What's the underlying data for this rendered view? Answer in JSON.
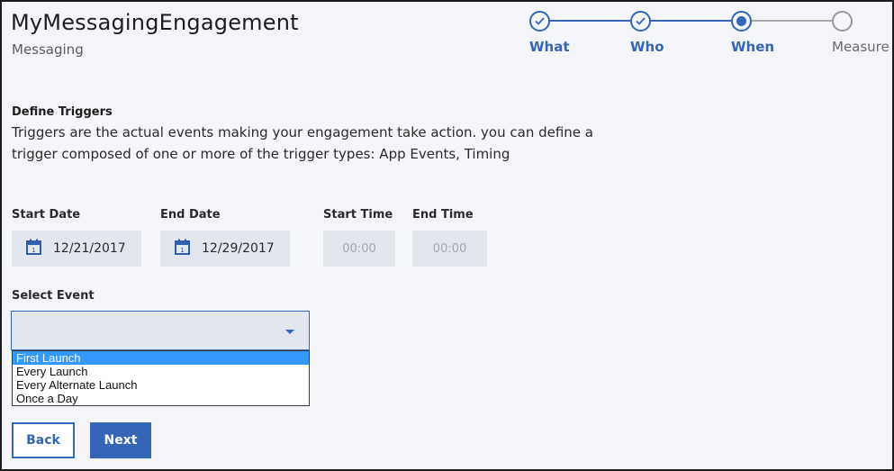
{
  "header": {
    "title": "MyMessagingEngagement",
    "subtitle": "Messaging"
  },
  "stepper": {
    "steps": [
      {
        "label": "What",
        "state": "done"
      },
      {
        "label": "Who",
        "state": "done"
      },
      {
        "label": "When",
        "state": "current"
      },
      {
        "label": "Measure",
        "state": "pending"
      }
    ]
  },
  "section": {
    "heading": "Define Triggers",
    "description": "Triggers are the actual events making your engagement take action. you can define a trigger composed of one or more of the trigger types: App Events, Timing"
  },
  "fields": {
    "start_date": {
      "label": "Start Date",
      "value": "12/21/2017",
      "icon": "calendar-icon"
    },
    "end_date": {
      "label": "End Date",
      "value": "12/29/2017",
      "icon": "calendar-icon"
    },
    "start_time": {
      "label": "Start Time",
      "placeholder": "00:00"
    },
    "end_time": {
      "label": "End Time",
      "placeholder": "00:00"
    }
  },
  "select_event": {
    "label": "Select Event",
    "value": "",
    "options": [
      "First Launch",
      "Every Launch",
      "Every Alternate Launch",
      "Once a Day"
    ],
    "highlighted": "First Launch"
  },
  "buttons": {
    "back": "Back",
    "next": "Next"
  },
  "colors": {
    "accent": "#3565b6",
    "background": "#f4f5f9",
    "highlight": "#3399ff"
  }
}
